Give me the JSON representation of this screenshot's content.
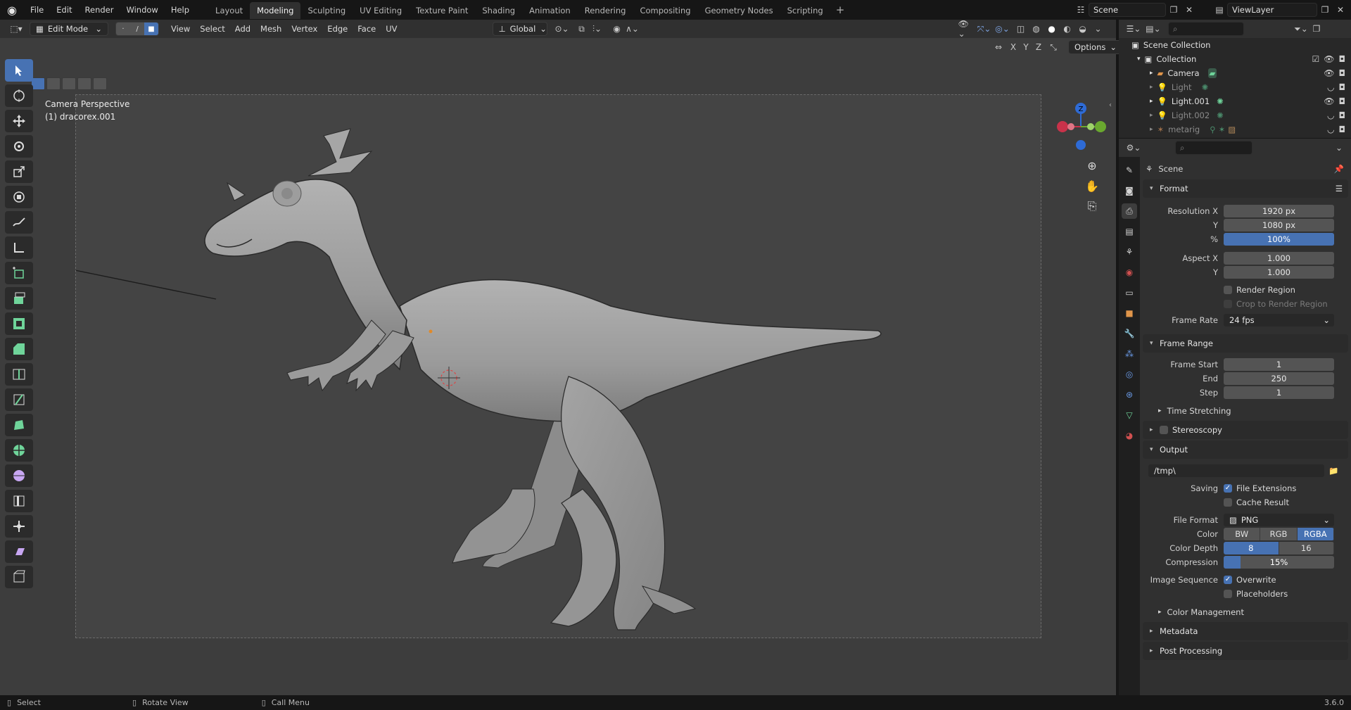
{
  "topbar": {
    "menus": [
      "File",
      "Edit",
      "Render",
      "Window",
      "Help"
    ],
    "workspaces": [
      "Layout",
      "Modeling",
      "Sculpting",
      "UV Editing",
      "Texture Paint",
      "Shading",
      "Animation",
      "Rendering",
      "Compositing",
      "Geometry Nodes",
      "Scripting"
    ],
    "active_workspace": "Modeling",
    "scene": "Scene",
    "view_layer": "ViewLayer"
  },
  "viewport_header": {
    "mode": "Edit Mode",
    "menus": [
      "View",
      "Select",
      "Add",
      "Mesh",
      "Vertex",
      "Edge",
      "Face",
      "UV"
    ],
    "transform_orientation": "Global",
    "axis_labels": [
      "X",
      "Y",
      "Z"
    ],
    "options_label": "Options"
  },
  "viewport": {
    "view_name": "Camera Perspective",
    "object_name": "(1) dracorex.001",
    "gizmo_z": "Z"
  },
  "outliner": {
    "root": "Scene Collection",
    "collection": "Collection",
    "items": [
      {
        "name": "Camera",
        "dim": false
      },
      {
        "name": "Light",
        "dim": true
      },
      {
        "name": "Light.001",
        "dim": false
      },
      {
        "name": "Light.002",
        "dim": true
      },
      {
        "name": "metarig",
        "dim": true
      }
    ]
  },
  "properties": {
    "context": "Scene",
    "format": {
      "title": "Format",
      "resolution_x_label": "Resolution X",
      "resolution_x": "1920 px",
      "resolution_y_label": "Y",
      "resolution_y": "1080 px",
      "percent_label": "%",
      "percent": "100%",
      "aspect_x_label": "Aspect X",
      "aspect_x": "1.000",
      "aspect_y_label": "Y",
      "aspect_y": "1.000",
      "render_region": "Render Region",
      "crop_region": "Crop to Render Region",
      "frame_rate_label": "Frame Rate",
      "frame_rate": "24 fps"
    },
    "frame_range": {
      "title": "Frame Range",
      "start_label": "Frame Start",
      "start": "1",
      "end_label": "End",
      "end": "250",
      "step_label": "Step",
      "step": "1",
      "time_stretching": "Time Stretching"
    },
    "stereoscopy": "Stereoscopy",
    "output": {
      "title": "Output",
      "path": "/tmp\\",
      "saving_label": "Saving",
      "file_extensions": "File Extensions",
      "cache_result": "Cache Result",
      "file_format_label": "File Format",
      "file_format": "PNG",
      "color_label": "Color",
      "color_options": [
        "BW",
        "RGB",
        "RGBA"
      ],
      "color_selected": "RGBA",
      "color_depth_label": "Color Depth",
      "color_depth_options": [
        "8",
        "16"
      ],
      "color_depth_selected": "8",
      "compression_label": "Compression",
      "compression": "15%",
      "compression_value": 0.15,
      "image_sequence_label": "Image Sequence",
      "overwrite": "Overwrite",
      "placeholders": "Placeholders",
      "color_management": "Color Management"
    },
    "metadata": "Metadata",
    "post_processing": "Post Processing"
  },
  "statusbar": {
    "items": [
      "Select",
      "Rotate View",
      "Call Menu"
    ],
    "version": "3.6.0"
  },
  "colors": {
    "accent": "#4772b3",
    "header": "#303030",
    "viewport": "#3d3d3d"
  }
}
